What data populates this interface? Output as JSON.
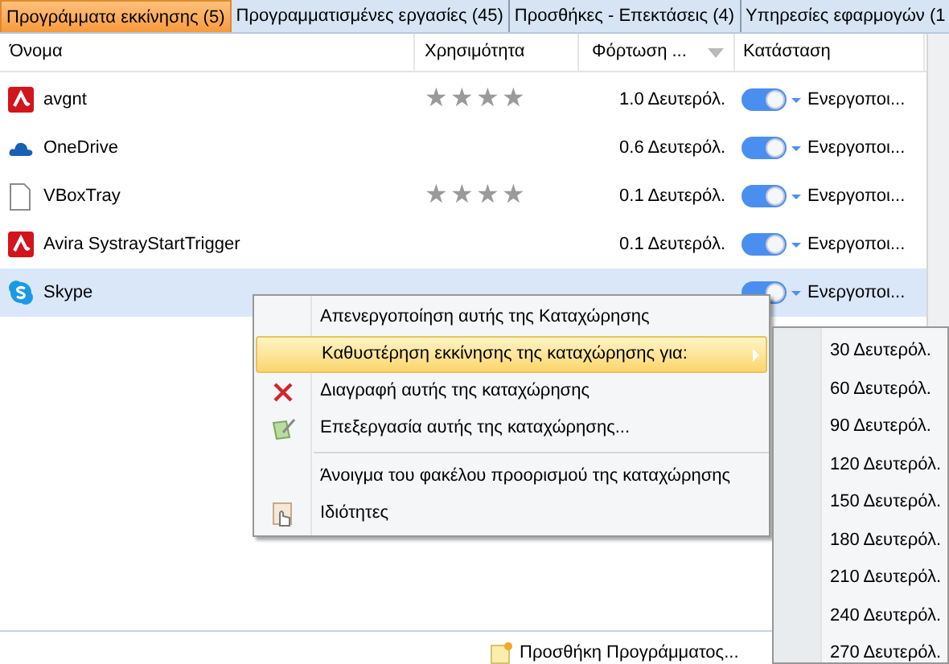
{
  "tabs": [
    {
      "label": "Προγράμματα εκκίνησης (5)",
      "selected": true
    },
    {
      "label": "Προγραμματισμένες εργασίες (45)",
      "selected": false
    },
    {
      "label": "Προσθήκες - Επεκτάσεις (4)",
      "selected": false
    },
    {
      "label": "Υπηρεσίες εφαρμογών (1",
      "selected": false
    }
  ],
  "table": {
    "columns": [
      "Όνομα",
      "Χρησιμότητα",
      "Φόρτωση ...",
      "Κατάσταση"
    ],
    "rows": [
      {
        "name": "avgnt",
        "kind": "avira",
        "stars": 4,
        "load": "1.0 Δευτερόλ.",
        "on": true,
        "status": "Ενεργοποι...",
        "selected": false
      },
      {
        "name": "OneDrive",
        "kind": "cloud",
        "load": "0.6 Δευτερόλ.",
        "on": true,
        "status": "Ενεργοποι...",
        "selected": false
      },
      {
        "name": "VBoxTray",
        "kind": "file",
        "stars": 4,
        "load": "0.1 Δευτερόλ.",
        "on": true,
        "status": "Ενεργοποι...",
        "selected": false
      },
      {
        "name": "Avira SystrayStartTrigger",
        "kind": "avira",
        "load": "0.1 Δευτερόλ.",
        "on": true,
        "status": "Ενεργοποι...",
        "selected": false
      },
      {
        "name": "Skype",
        "kind": "skype",
        "on": true,
        "status": "Ενεργοποι...",
        "selected": true
      }
    ]
  },
  "context_menu": {
    "items": [
      {
        "label": "Απενεργοποίηση αυτής της Καταχώρησης",
        "selected": false
      },
      {
        "label": "Καθυστέρηση εκκίνησης της καταχώρησης για:",
        "selected": true,
        "submenu": true
      },
      {
        "label": "Διαγραφή αυτής της καταχώρησης",
        "selected": false,
        "kind": "delete"
      },
      {
        "label": "Επεξεργασία αυτής της καταχώρησης...",
        "selected": false,
        "kind": "edit"
      },
      {
        "kind": "separator"
      },
      {
        "label": "Άνοιγμα του φακέλου προορισμού της καταχώρησης",
        "selected": false
      },
      {
        "label": "Ιδιότητες",
        "selected": false,
        "kind": "properties"
      }
    ]
  },
  "submenu": {
    "items": [
      "30 Δευτερόλ.",
      "60 Δευτερόλ.",
      "90 Δευτερόλ.",
      "120 Δευτερόλ.",
      "150 Δευτερόλ.",
      "180 Δευτερόλ.",
      "210 Δευτερόλ.",
      "240 Δευτερόλ.",
      "270 Δευτερόλ."
    ]
  },
  "footer": {
    "add_button": "Προσθήκη Προγράμματος..."
  }
}
